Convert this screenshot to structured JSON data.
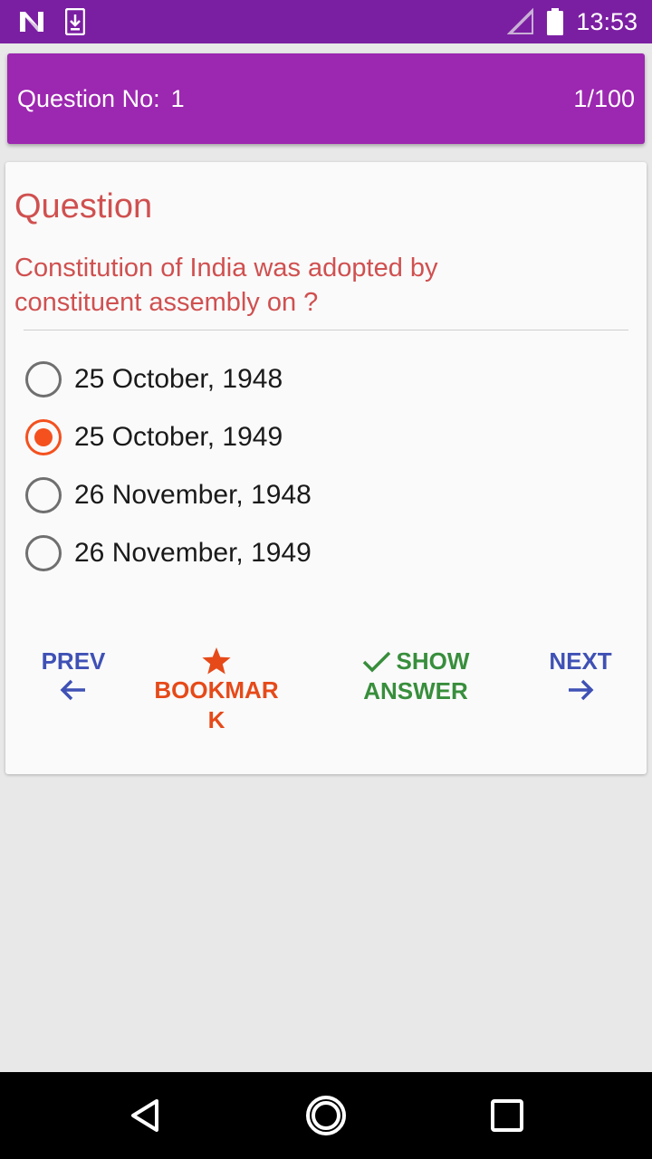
{
  "status_bar": {
    "time": "13:53",
    "icons": [
      "notification-n-icon",
      "download-icon",
      "signal-icon",
      "battery-icon"
    ],
    "color": "#7b1fa2"
  },
  "header": {
    "question_label": "Question No:",
    "question_number": "1",
    "progress": "1/100",
    "color": "#9c27b0"
  },
  "question": {
    "heading": "Question",
    "text": "Constitution of India was adopted by constituent assembly on ?",
    "color": "#d05050"
  },
  "options": [
    {
      "label": "25 October, 1948",
      "selected": false
    },
    {
      "label": "25 October, 1949",
      "selected": true
    },
    {
      "label": "26 November, 1948",
      "selected": false
    },
    {
      "label": "26 November, 1949",
      "selected": false
    }
  ],
  "actions": {
    "prev_label": "PREV",
    "bookmark_label_line1": "BOOKMAR",
    "bookmark_label_line2": "K",
    "show_label_line1": "SHOW",
    "show_label_line2": "ANSWER",
    "next_label": "NEXT",
    "colors": {
      "nav": "#3f51b5",
      "bookmark": "#e64a19",
      "show": "#388e3c",
      "selected": "#f4511e"
    }
  },
  "nav_bar": {
    "icons": [
      "back-icon",
      "home-icon",
      "recent-apps-icon"
    ]
  }
}
